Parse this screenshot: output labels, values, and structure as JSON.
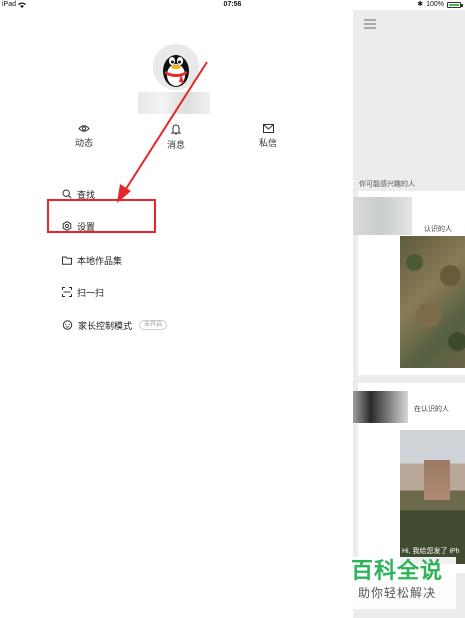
{
  "status_bar": {
    "device": "iPad",
    "time": "07:56",
    "battery": "100%",
    "battery_level": 1.0
  },
  "drawer": {
    "quick_actions": [
      {
        "label": "动态",
        "icon": "eye-icon"
      },
      {
        "label": "消息",
        "icon": "bell-icon"
      },
      {
        "label": "私信",
        "icon": "mail-icon"
      }
    ],
    "menu": [
      {
        "label": "查找",
        "icon": "search-icon"
      },
      {
        "label": "设置",
        "icon": "gear-icon"
      },
      {
        "label": "本地作品集",
        "icon": "folder-icon"
      },
      {
        "label": "扫一扫",
        "icon": "scan-icon"
      },
      {
        "label": "家长控制模式",
        "icon": "child-face-icon",
        "badge": "未开启"
      }
    ]
  },
  "panel": {
    "section_title": "你可能感兴趣的人",
    "cards": [
      {
        "label": "认识的人"
      },
      {
        "label": "在认识的人",
        "photo_caption": "Hi, 我给您发了 iPh"
      }
    ]
  },
  "watermark": {
    "title": "百科全说",
    "subtitle": "助你轻松解决"
  },
  "colors": {
    "highlight": "#e5262a",
    "arrow": "#e5262a",
    "watermark_green": "#2db35a"
  }
}
